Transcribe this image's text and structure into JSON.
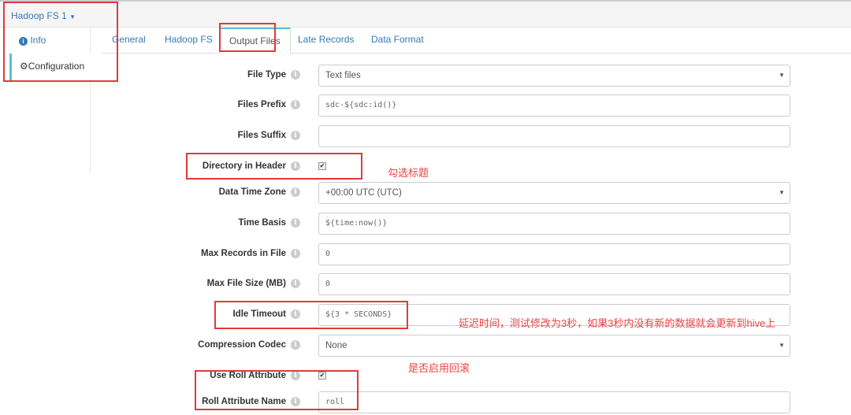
{
  "header": {
    "title": "Hadoop FS 1"
  },
  "sidebar": {
    "items": [
      {
        "label": "Info",
        "icon": "info-icon"
      },
      {
        "label": "Configuration",
        "icon": "gear-icon"
      }
    ]
  },
  "tabs": [
    {
      "label": "General"
    },
    {
      "label": "Hadoop FS"
    },
    {
      "label": "Output Files",
      "active": true
    },
    {
      "label": "Late Records"
    },
    {
      "label": "Data Format"
    }
  ],
  "fields": [
    {
      "label": "File Type",
      "type": "select",
      "value": "Text files"
    },
    {
      "label": "Files Prefix",
      "type": "code",
      "value": "sdc-${sdc:id()}"
    },
    {
      "label": "Files Suffix",
      "type": "text",
      "value": ""
    },
    {
      "label": "Directory in Header",
      "type": "checkbox",
      "checked": true
    },
    {
      "label": "Data Time Zone",
      "type": "select",
      "value": "+00:00 UTC (UTC)"
    },
    {
      "label": "Time Basis",
      "type": "code",
      "value": "${time:now()}"
    },
    {
      "label": "Max Records in File",
      "type": "code",
      "value": "0"
    },
    {
      "label": "Max File Size (MB)",
      "type": "code",
      "value": "0"
    },
    {
      "label": "Idle Timeout",
      "type": "code",
      "value": "${3 * SECONDS}"
    },
    {
      "label": "Compression Codec",
      "type": "select",
      "value": "None"
    },
    {
      "label": "Use Roll Attribute",
      "type": "checkbox",
      "checked": true
    },
    {
      "label": "Roll Attribute Name",
      "type": "code",
      "value": "roll"
    }
  ],
  "annotations": {
    "directory_header": "勾选标题",
    "idle_timeout": "延迟时间，测试修改为3秒，如果3秒内没有新的数据就会更新到hive上",
    "roll_attribute": "是否启用回滚",
    "color": "#e84545"
  }
}
